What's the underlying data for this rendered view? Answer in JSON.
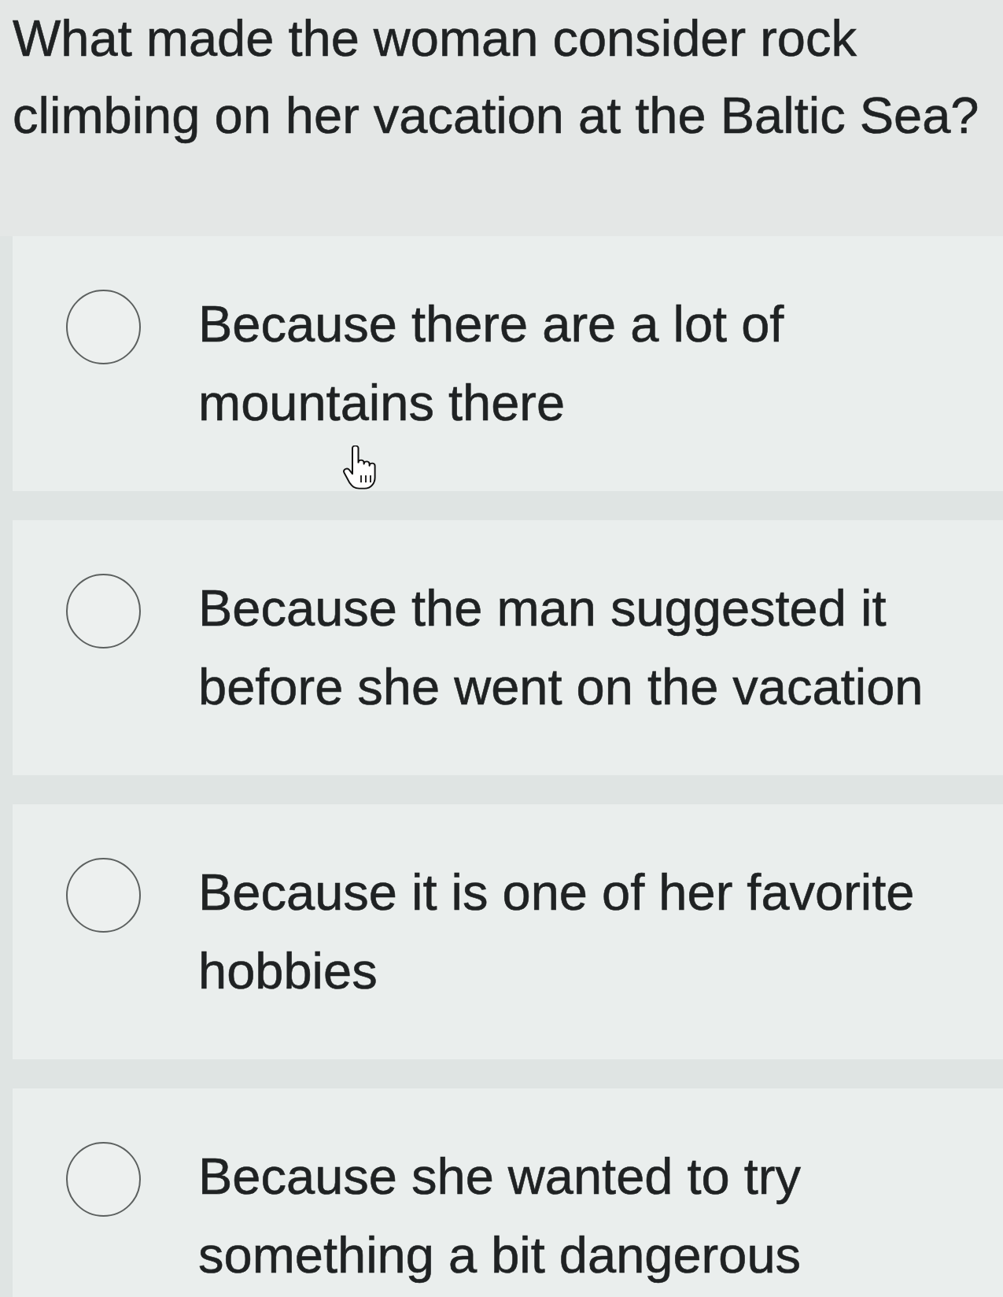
{
  "question": "What made the woman consider rock climbing on her vacation at the Baltic Sea?",
  "options": [
    {
      "label": "Because there are a lot of mountains there",
      "selected": false
    },
    {
      "label": "Because the man suggested it before she went on the vacation",
      "selected": false
    },
    {
      "label": "Because it is one of her favorite hobbies",
      "selected": false
    },
    {
      "label": "Because she wanted to try something a bit dangerous",
      "selected": false
    }
  ]
}
